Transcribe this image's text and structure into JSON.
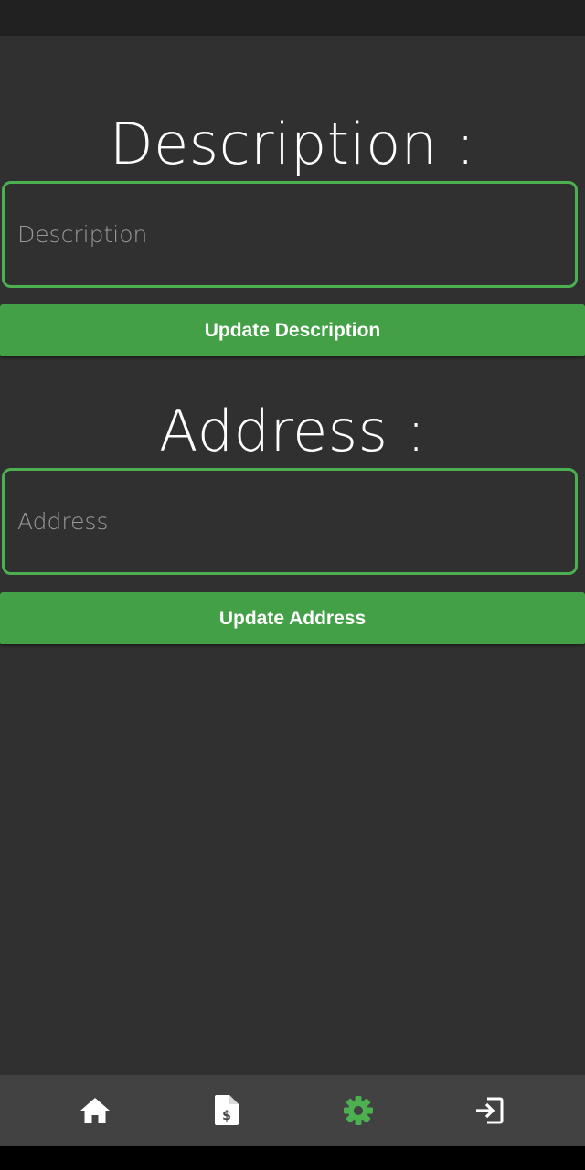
{
  "description_section": {
    "title": "Description :",
    "input_placeholder": "Description",
    "input_value": "",
    "button_label": "Update Description"
  },
  "address_section": {
    "title": "Address :",
    "input_placeholder": "Address",
    "input_value": "",
    "button_label": "Update Address"
  },
  "bottom_nav": {
    "items": [
      {
        "icon": "home-icon",
        "active": false
      },
      {
        "icon": "invoice-dollar-icon",
        "active": false
      },
      {
        "icon": "gear-icon",
        "active": true
      },
      {
        "icon": "logout-icon",
        "active": false
      }
    ]
  },
  "colors": {
    "background": "#303030",
    "accent": "#43a047",
    "field_border": "#4caf50",
    "nav_background": "#424242",
    "status_bar": "#212121",
    "icon_default": "#ffffff",
    "icon_active": "#4caf50"
  }
}
